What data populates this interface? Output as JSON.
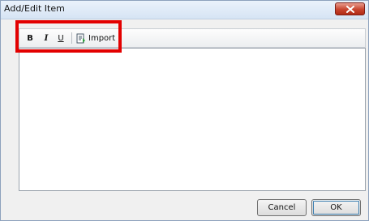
{
  "window": {
    "title": "Add/Edit Item"
  },
  "toolbar": {
    "bold_label": "B",
    "italic_label": "I",
    "underline_label": "U",
    "import_label": "Import"
  },
  "buttons": {
    "cancel": "Cancel",
    "ok": "OK"
  },
  "colors": {
    "highlight": "#e30000",
    "close_button": "#c8442e"
  },
  "icons": {
    "close": "close-icon",
    "import": "import-icon"
  }
}
